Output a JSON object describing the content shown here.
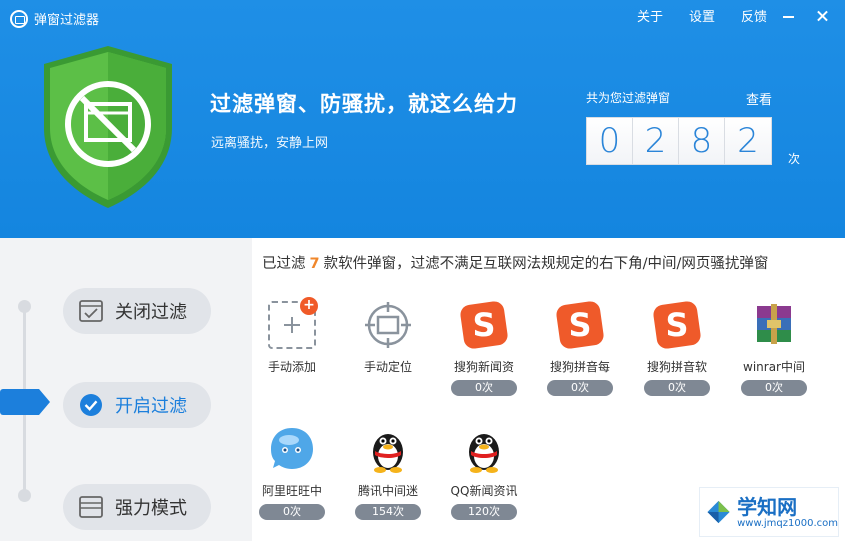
{
  "window": {
    "title": "弹窗过滤器",
    "menu": [
      "关于",
      "设置",
      "反馈"
    ]
  },
  "hero": {
    "headline": "过滤弹窗、防骚扰，就这么给力",
    "subline": "远离骚扰，安静上网",
    "counter_label": "共为您过滤弹窗",
    "view_label": "查看",
    "digits": [
      "0",
      "2",
      "8",
      "2"
    ],
    "unit": "次"
  },
  "modes": {
    "off": "关闭过滤",
    "on": "开启过滤",
    "strong": "强力模式",
    "active": "on"
  },
  "summary": {
    "prefix": "已过滤",
    "count": "7",
    "suffix": "款软件弹窗，过滤不满足互联网法规规定的右下角/中间/网页骚扰弹窗"
  },
  "apps": [
    {
      "name": "手动添加",
      "icon": "add-icon",
      "badge": ""
    },
    {
      "name": "手动定位",
      "icon": "crosshair-icon",
      "badge": ""
    },
    {
      "name": "搜狗新闻资",
      "icon": "sogou-icon",
      "badge": "0次"
    },
    {
      "name": "搜狗拼音每",
      "icon": "sogou-icon",
      "badge": "0次"
    },
    {
      "name": "搜狗拼音软",
      "icon": "sogou-icon",
      "badge": "0次"
    },
    {
      "name": "winrar中间",
      "icon": "winrar-icon",
      "badge": "0次"
    },
    {
      "name": "阿里旺旺中",
      "icon": "aliwangwang-icon",
      "badge": "0次"
    },
    {
      "name": "腾讯中间迷",
      "icon": "qq-penguin-icon",
      "badge": "154次"
    },
    {
      "name": "QQ新闻资讯",
      "icon": "qq-penguin-icon",
      "badge": "120次"
    }
  ],
  "add_badge": "+",
  "watermark": {
    "title": "学知网",
    "url": "www.jmqz1000.com"
  },
  "colors": {
    "header_blue": "#1485df",
    "accent_blue": "#1c7fdc",
    "count_orange": "#f0872b",
    "shield_green": "#4caf3e"
  }
}
